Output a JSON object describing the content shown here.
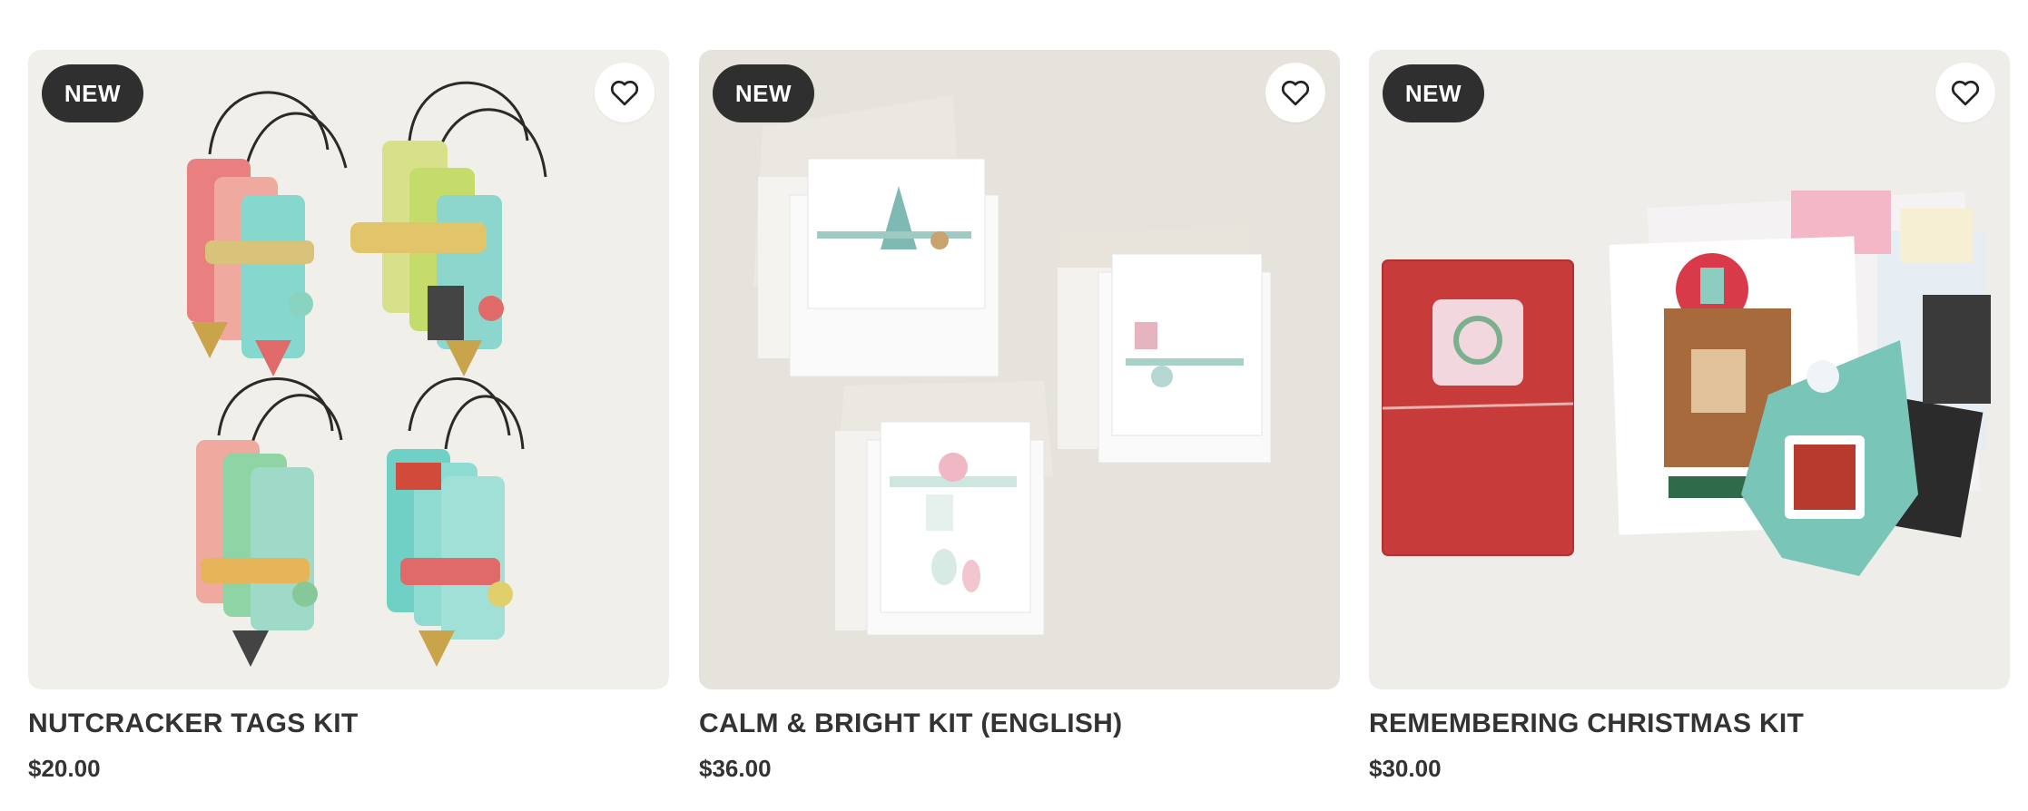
{
  "products": [
    {
      "badge": "NEW",
      "title": "NUTCRACKER TAGS KIT",
      "price": "$20.00",
      "image_alt": "Nutcracker tags kit product photo",
      "favorite_icon": "heart-outline-icon"
    },
    {
      "badge": "NEW",
      "title": "CALM & BRIGHT KIT (ENGLISH)",
      "price": "$36.00",
      "image_alt": "Calm & Bright kit cards and envelopes",
      "favorite_icon": "heart-outline-icon"
    },
    {
      "badge": "NEW",
      "title": "REMEMBERING CHRISTMAS KIT",
      "price": "$30.00",
      "image_alt": "Remembering Christmas kit scrapbook pages",
      "favorite_icon": "heart-outline-icon"
    }
  ],
  "colors": {
    "badge_bg": "#2f2f2f",
    "text": "#333333",
    "card_bg_1": "#f1efea",
    "card_bg_2": "#e6e3dd",
    "card_bg_3": "#efede9"
  }
}
